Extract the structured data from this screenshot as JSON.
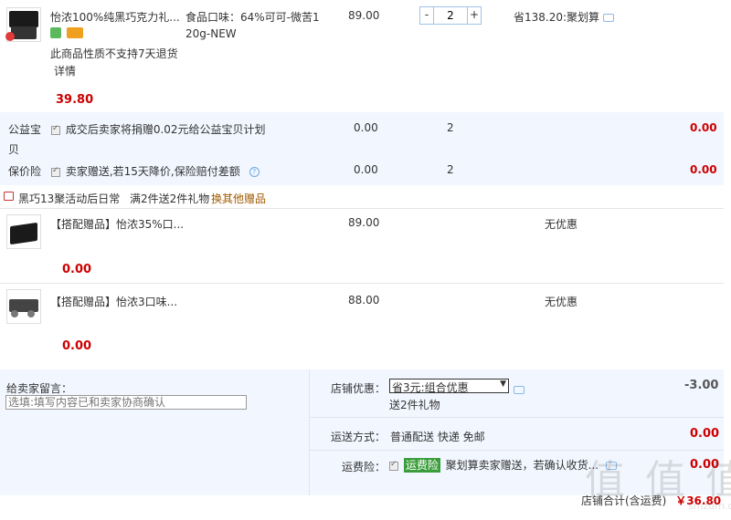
{
  "item": {
    "title": "怡浓100%纯黑巧克力礼...",
    "spec": "食品口味：64%可可-微苦120g-NEW",
    "price": "89.00",
    "quantity": "2",
    "minus": "-",
    "plus": "+",
    "promo": "省138.20:聚划算",
    "no_return": "此商品性质不支持7天退货",
    "detail_link": "详情",
    "sale_price": "39.80"
  },
  "charity": {
    "label": "公益宝贝",
    "text": "成交后卖家将捐赠0.02元给公益宝贝计划",
    "price": "0.00",
    "qty": "2",
    "total": "0.00"
  },
  "insurance": {
    "label": "保价险",
    "text": "卖家赠送,若15天降价,保险赔付差额",
    "price": "0.00",
    "qty": "2",
    "total": "0.00",
    "help": "?"
  },
  "gift_header": {
    "activity": "黑巧13聚活动后日常",
    "rule": "满2件送2件礼物",
    "change_link": "换其他赠品"
  },
  "gifts": [
    {
      "title": "【搭配赠品】怡浓35%口...",
      "price": "89.00",
      "promo": "无优惠",
      "total": "0.00"
    },
    {
      "title": "【搭配赠品】怡浓3口味...",
      "price": "88.00",
      "promo": "无优惠",
      "total": "0.00"
    }
  ],
  "message": {
    "label": "给卖家留言：",
    "placeholder": "选填:填写内容已和卖家协商确认"
  },
  "shop_discount": {
    "label": "店铺优惠：",
    "selected": "省3元:组合优惠",
    "gift_note": "送2件礼物",
    "amount": "-3.00"
  },
  "shipping": {
    "label": "运送方式：",
    "value": "普通配送 快递 免邮",
    "amount": "0.00"
  },
  "freight_insurance": {
    "label": "运费险：",
    "badge": "运费险",
    "text": "聚划算卖家赠送，若确认收货...",
    "amount": "0.00"
  },
  "total": {
    "label": "店铺合计(含运费)",
    "amount": "￥36.80"
  },
  "watermark": {
    "text": "值 值 值",
    "sub": "smzdm.com"
  },
  "colors": {
    "price_red": "#cc0000",
    "panel_blue": "#f2f7ff",
    "badge_green": "#3a9d3a"
  }
}
